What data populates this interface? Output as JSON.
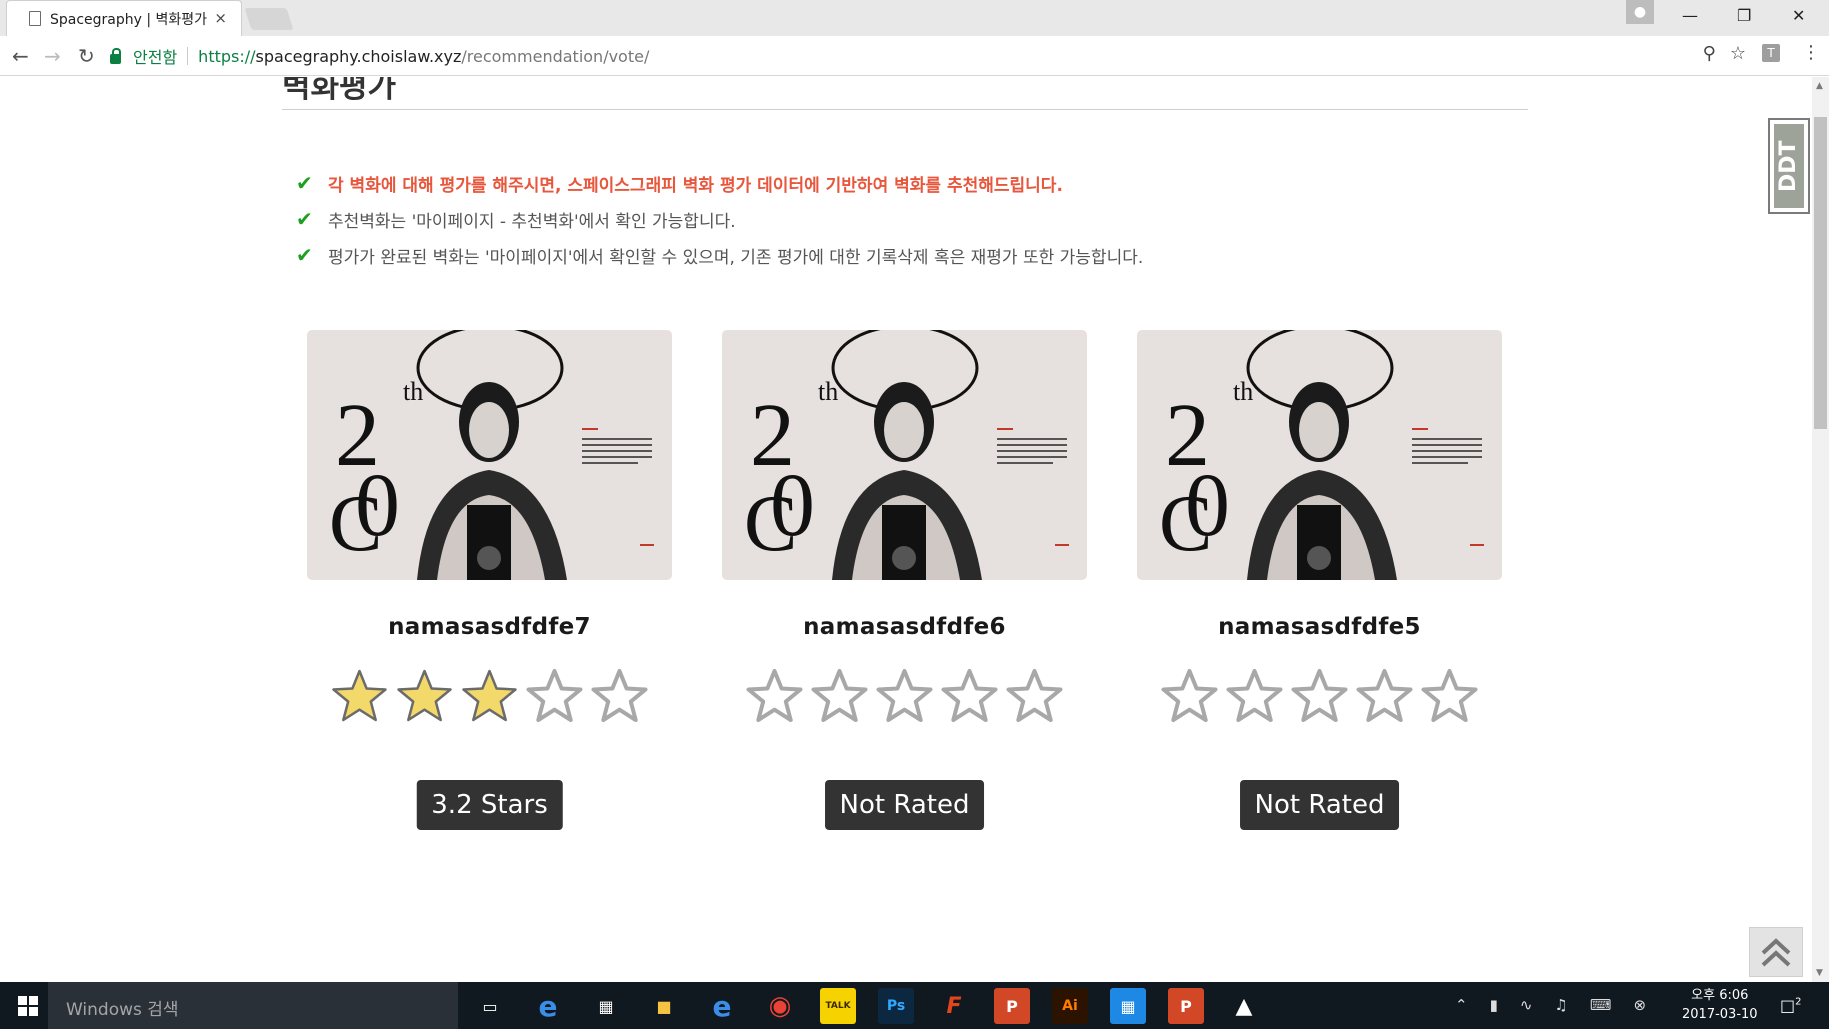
{
  "browser": {
    "tab_title": "Spacegraphy | 벽화평가",
    "tab_close": "×",
    "secure_label": "안전함",
    "url_scheme": "https://",
    "url_host": "spacegraphy.choislaw.xyz",
    "url_path": "/recommendation/vote/",
    "extension_letter": "T"
  },
  "page": {
    "heading": "벽화평가",
    "notices": [
      "각 벽화에 대해 평가를 해주시면, 스페이스그래피 벽화 평가 데이터에 기반하여 벽화를 추천해드립니다.",
      "추천벽화는 '마이페이지 - 추천벽화'에서 확인 가능합니다.",
      "평가가 완료된 벽화는 '마이페이지'에서 확인할 수 있으며, 기존 평가에 대한 기록삭제 혹은 재평가 또한 가능합니다."
    ],
    "murals": [
      {
        "name": "namasasdfdfe7",
        "rating": 3.2,
        "rating_label": "3.2 Stars"
      },
      {
        "name": "namasasdfdfe6",
        "rating": 0,
        "rating_label": "Not Rated"
      },
      {
        "name": "namasasdfdfe5",
        "rating": 0,
        "rating_label": "Not Rated"
      }
    ],
    "side_widget": "DDT"
  },
  "taskbar": {
    "search_placeholder": "Windows 검색",
    "clock_time": "오후 6:06",
    "clock_date": "2017-03-10",
    "notification_count": "2"
  },
  "colors": {
    "accent_green": "#0b8043",
    "highlight_red": "#e8563c",
    "check_green": "#1da01d",
    "star_gold": "#f3d86a",
    "badge_dark": "#333333"
  }
}
